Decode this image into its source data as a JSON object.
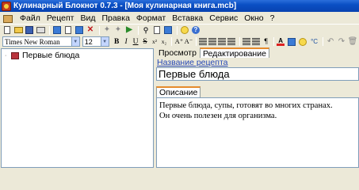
{
  "window": {
    "title": "Кулинарный Блокнот 0.7.3 - [Моя кулинарная книга.mcb]"
  },
  "menu": {
    "items": [
      "Файл",
      "Рецепт",
      "Вид",
      "Правка",
      "Формат",
      "Вставка",
      "Сервис",
      "Окно",
      "?"
    ]
  },
  "format_toolbar": {
    "font_name": "Times New Roman",
    "font_size": "12",
    "bold": "B",
    "italic": "I",
    "underline": "U",
    "strike": "S",
    "superscript": "x²",
    "subscript": "x₂",
    "grow_font": "A⁺",
    "shrink_font": "A⁻",
    "font_color": "A",
    "paragraph": "¶",
    "degree": "°C"
  },
  "tree": {
    "items": [
      {
        "label": "Первые блюда"
      }
    ]
  },
  "tabs": [
    {
      "label": "Просмотр",
      "active": false
    },
    {
      "label": "Редактирование",
      "active": true
    }
  ],
  "recipe": {
    "name_label": "Название рецепта",
    "name_value": "Первые блюда",
    "description_tab": "Описание",
    "description_lines": [
      "Первые блюда, супы, готовят во многих странах.",
      "Он очень полезен для организма."
    ]
  },
  "colors": {
    "title_bar": "#0a4fc4",
    "active_tab_accent": "#e68b2c",
    "link_blue": "#2547b6"
  }
}
